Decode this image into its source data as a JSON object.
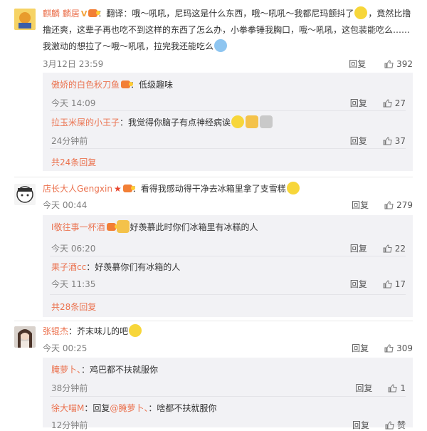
{
  "comments": [
    {
      "user": "麒麟 麟居",
      "text_parts": [
        "：翻译：哦～吼吼，尼玛这是什么东西，哦～吼吼～我都尼玛颤抖了",
        "，竟然比撸撸还爽，这辈子再也吃不到这样的东西了怎么办，小拳拳锤我胸口，哦～吼吼，这包装能吃么……我激动的想拉了～哦～吼吼，拉完我还能吃么"
      ],
      "time": "3月12日 23:59",
      "reply": "回复",
      "likes": "392",
      "replies": [
        {
          "user": "傲娇的白色秋刀鱼",
          "text": "：低级趣味",
          "time": "今天 14:09",
          "reply": "回复",
          "likes": "27"
        },
        {
          "user": "拉玉米屎的小王子",
          "text": "：我觉得你脑子有点神经病诶",
          "time": "24分钟前",
          "reply": "回复",
          "likes": "37"
        }
      ],
      "more": "共24条回复"
    },
    {
      "user": "店长大人Gengxin",
      "text": "：看得我感动得干净去冰箱里拿了支雪糕",
      "time": "今天 00:44",
      "reply": "回复",
      "likes": "279",
      "replies": [
        {
          "user": "I敬往事一杯酒",
          "text": "好羡慕此时你们冰箱里有冰糕的人",
          "time": "今天 06:20",
          "reply": "回复",
          "likes": "22"
        },
        {
          "user": "果子酒cc",
          "text": "：好羡慕你们有冰箱的人",
          "time": "今天 11:35",
          "reply": "回复",
          "likes": "17"
        }
      ],
      "more": "共28条回复"
    },
    {
      "user": "张锟杰",
      "text": "：芥末味儿的吧",
      "time": "今天 00:25",
      "reply": "回复",
      "likes": "309",
      "replies": [
        {
          "user": "腌萝卜、",
          "text": "：鸡巴都不扶就服你",
          "time": "38分钟前",
          "reply": "回复",
          "likes": "1"
        },
        {
          "user": "徐大喵M",
          "text_prefix": "：回复",
          "mention": "@腌萝卜、",
          "text": "：啥都不扶就服你",
          "time": "12分钟前",
          "reply": "回复",
          "likes": "赞"
        }
      ]
    }
  ],
  "colors": {
    "username": "#eb7350",
    "meta": "#808080",
    "reply_bg": "#f2f2f5"
  }
}
